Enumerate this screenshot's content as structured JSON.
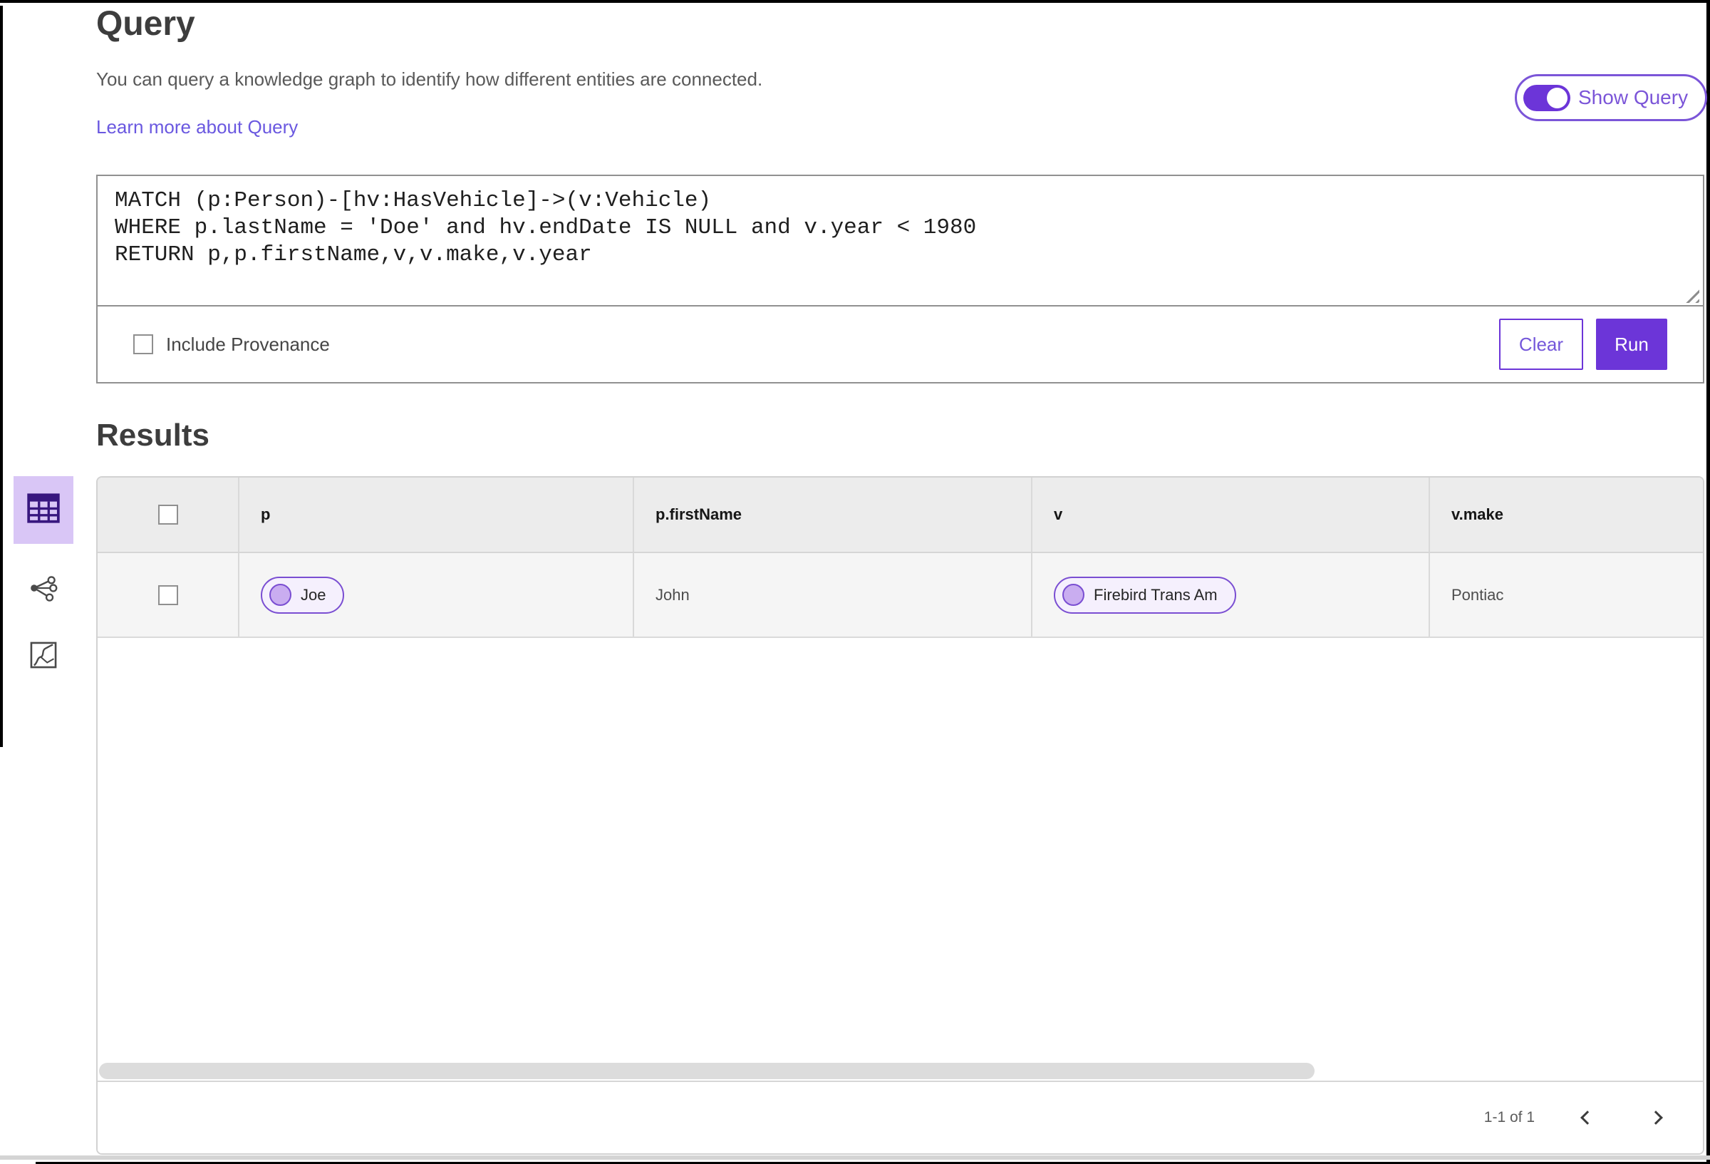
{
  "page": {
    "title": "Query",
    "description": "You can query a knowledge graph to identify how different entities are connected.",
    "learn_more": "Learn more about Query",
    "show_query": {
      "label": "Show Query",
      "enabled": true
    }
  },
  "query_editor": {
    "code": "MATCH (p:Person)-[hv:HasVehicle]->(v:Vehicle)\nWHERE p.lastName = 'Doe' and hv.endDate IS NULL and v.year < 1980\nRETURN p,p.firstName,v,v.make,v.year",
    "include_provenance": {
      "label": "Include Provenance",
      "checked": false
    },
    "clear_label": "Clear",
    "run_label": "Run"
  },
  "results": {
    "heading": "Results",
    "view_switcher": {
      "options": [
        "table-view-icon",
        "network-view-icon",
        "map-view-icon"
      ],
      "selected": "table-view-icon"
    },
    "columns": [
      "p",
      "p.firstName",
      "v",
      "v.make"
    ],
    "rows": [
      {
        "selected": false,
        "p": {
          "type": "entity-pill",
          "label": "Joe"
        },
        "p_firstName": "John",
        "v": {
          "type": "entity-pill",
          "label": "Firebird Trans Am"
        },
        "v_make": "Pontiac"
      }
    ],
    "pagination": {
      "range_label": "1-1 of 1"
    }
  },
  "colors": {
    "accent_purple": "#6c35d8",
    "toggle_outline": "#7b55d8",
    "link": "#6a58e0",
    "selected_tile_bg": "#d9c6f6",
    "selected_tile_icon": "#38177f",
    "pill_border": "#7a4ed2",
    "pill_bg": "#f5f0fd",
    "pill_dot": "#c9adf0",
    "table_header_bg": "#ececec",
    "row_bg": "#f5f5f5"
  }
}
